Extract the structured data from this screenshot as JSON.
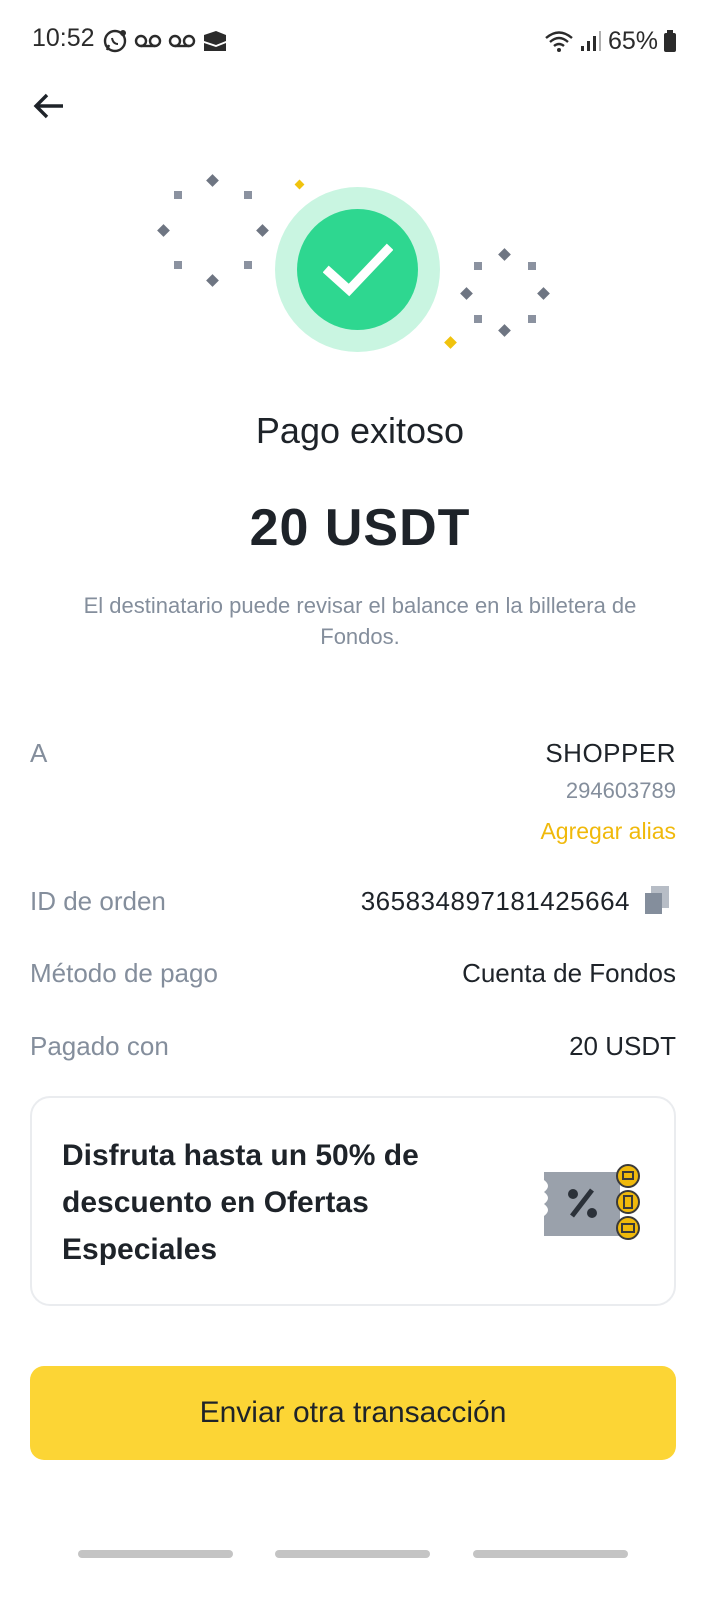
{
  "status_bar": {
    "time": "10:52",
    "battery": "65%",
    "left_icons": [
      "whatsapp-icon",
      "voicemail-icon",
      "voicemail-icon",
      "app-notification-icon"
    ],
    "right_icons": [
      "wifi-icon",
      "signal-icon",
      "battery-icon"
    ]
  },
  "header": {
    "back_icon": "arrow-left-icon"
  },
  "result": {
    "title": "Pago exitoso",
    "amount": "20 USDT",
    "note": "El destinatario puede revisar el balance en la billetera de Fondos."
  },
  "details": {
    "recipient_label": "A",
    "recipient_name": "SHOPPER",
    "recipient_id": "294603789",
    "add_alias": "Agregar alias",
    "order_id_label": "ID de orden",
    "order_id": "365834897181425664",
    "method_label": "Método de pago",
    "method_value": "Cuenta de Fondos",
    "paid_with_label": "Pagado con",
    "paid_with_value": "20 USDT"
  },
  "promo": {
    "text": "Disfruta hasta un 50% de descuento en Ofertas Especiales",
    "icon": "coupon-icon"
  },
  "actions": {
    "primary": "Enviar otra transacción"
  },
  "colors": {
    "accent": "#fcd535",
    "alias": "#f0b90b",
    "success": "#2ed790",
    "success_halo": "#c9f5e1",
    "muted_text": "#848e9c"
  }
}
